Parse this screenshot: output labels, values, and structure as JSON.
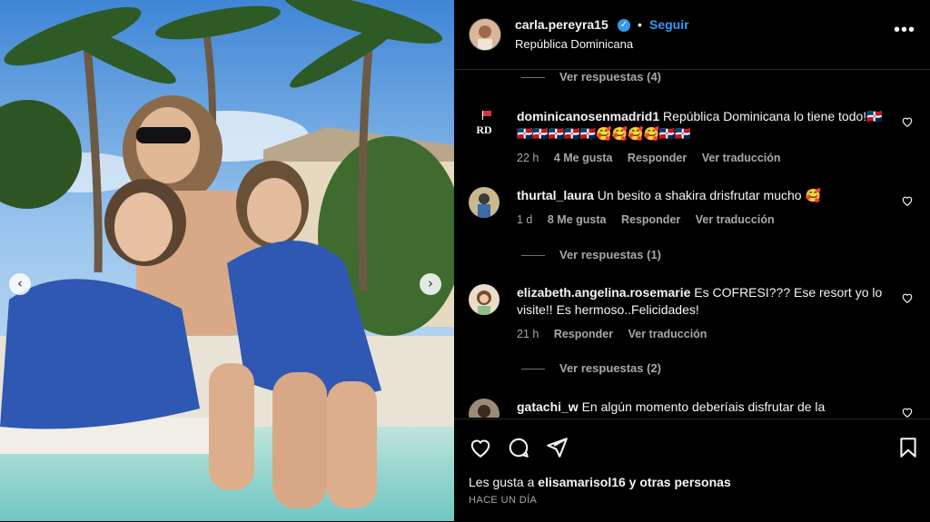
{
  "post": {
    "username": "carla.pereyra15",
    "verified_glyph": "✓",
    "separator": "•",
    "follow_label": "Seguir",
    "location": "República Dominicana",
    "more_label": "•••"
  },
  "photo": {
    "description_icon": "photo-of-woman-with-two-girls-at-pool",
    "prev_label": "‹",
    "next_label": "›"
  },
  "comments": {
    "replies_top": "Ver respuestas (4)",
    "items": [
      {
        "username": "dominicanosenmadrid1",
        "text": "República Dominicana lo tiene todo!🇩🇴🇩🇴🇩🇴🇩🇴🇩🇴🇩🇴🥰🥰🥰🥰🇩🇴🇩🇴",
        "time": "22 h",
        "likes": "4 Me gusta",
        "reply": "Responder",
        "translate": "Ver traducción",
        "avatar_label": "RD"
      },
      {
        "username": "thurtal_laura",
        "text": "Un besito a shakira drisfrutar mucho 🥰",
        "time": "1 d",
        "likes": "8 Me gusta",
        "reply": "Responder",
        "translate": "Ver traducción",
        "replies": "Ver respuestas (1)"
      },
      {
        "username": "elizabeth.angelina.rosemarie",
        "text": "Es COFRESI??? Ese resort yo lo visite!! Es hermoso..Felicidades!",
        "time": "21 h",
        "reply": "Responder",
        "translate": "Ver traducción",
        "replies": "Ver respuestas (2)"
      },
      {
        "username": "gatachi_w",
        "text": "En algún momento deberíais disfrutar de la"
      }
    ]
  },
  "actions": {
    "icons": [
      "heart-icon",
      "comment-icon",
      "share-icon",
      "bookmark-icon"
    ],
    "likes_prefix": "Les gusta a ",
    "likes_user": "elisamarisol16",
    "likes_suffix": " y otras personas",
    "date": "HACE UN DÍA"
  },
  "colors": {
    "accent": "#3797f0",
    "muted": "#a8a8a8",
    "background": "#000000"
  }
}
